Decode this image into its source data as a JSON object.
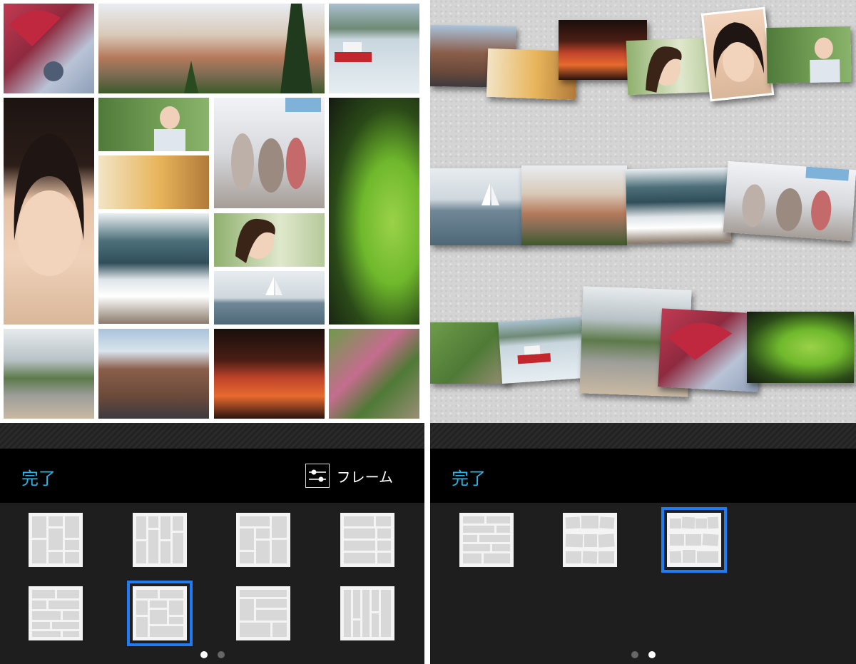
{
  "left_screen": {
    "toolbar": {
      "done_label": "完了",
      "frame_label": "フレーム"
    },
    "layout_options_count": 8,
    "selected_layout_index": 5,
    "page_indicator": {
      "pages": 2,
      "current": 1
    }
  },
  "right_screen": {
    "toolbar": {
      "done_label": "完了"
    },
    "layout_options_count": 3,
    "selected_layout_index": 2,
    "page_indicator": {
      "pages": 2,
      "current": 2
    }
  },
  "colors": {
    "accent": "#28b6e8",
    "selection": "#1f7cf2",
    "toolbar_bg": "#000000",
    "tray_bg": "#1e1e1e"
  },
  "icons": {
    "frame": "sliders-icon"
  }
}
